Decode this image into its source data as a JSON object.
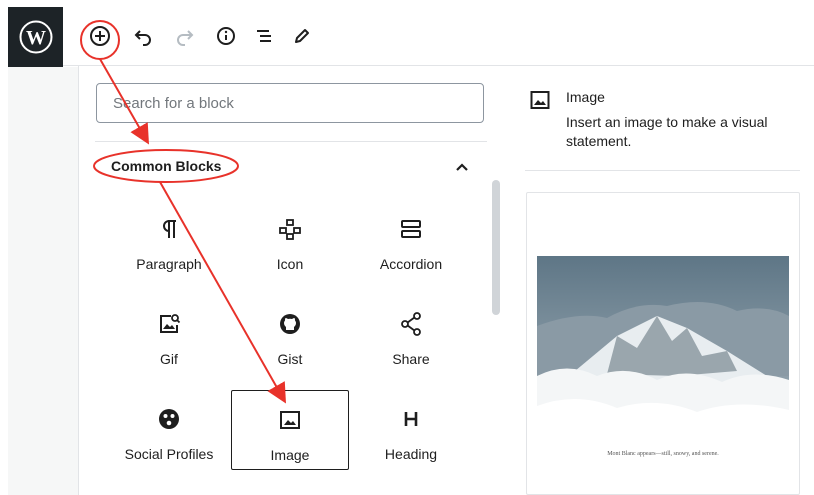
{
  "inserter": {
    "search_placeholder": "Search for a block",
    "category_title": "Common Blocks",
    "blocks": [
      {
        "label": "Paragraph",
        "icon": "paragraph-icon"
      },
      {
        "label": "Icon",
        "icon": "icon-block-icon"
      },
      {
        "label": "Accordion",
        "icon": "accordion-icon"
      },
      {
        "label": "Gif",
        "icon": "gif-icon"
      },
      {
        "label": "Gist",
        "icon": "github-icon"
      },
      {
        "label": "Share",
        "icon": "share-icon"
      },
      {
        "label": "Social Profiles",
        "icon": "social-profiles-icon"
      },
      {
        "label": "Image",
        "icon": "image-icon",
        "selected": true
      },
      {
        "label": "Heading",
        "icon": "heading-icon"
      }
    ]
  },
  "preview": {
    "title": "Image",
    "description": "Insert an image to make a visual statement.",
    "caption": "Mont Blanc appears—still, snowy, and serene."
  },
  "toolbar": {
    "icons": [
      "add-block-icon",
      "undo-icon",
      "redo-icon",
      "info-icon",
      "outline-icon",
      "edit-icon"
    ]
  },
  "colors": {
    "annotation": "#e8322a",
    "admin_bar": "#1d2327",
    "scrollbar": "#d0d4d8"
  }
}
